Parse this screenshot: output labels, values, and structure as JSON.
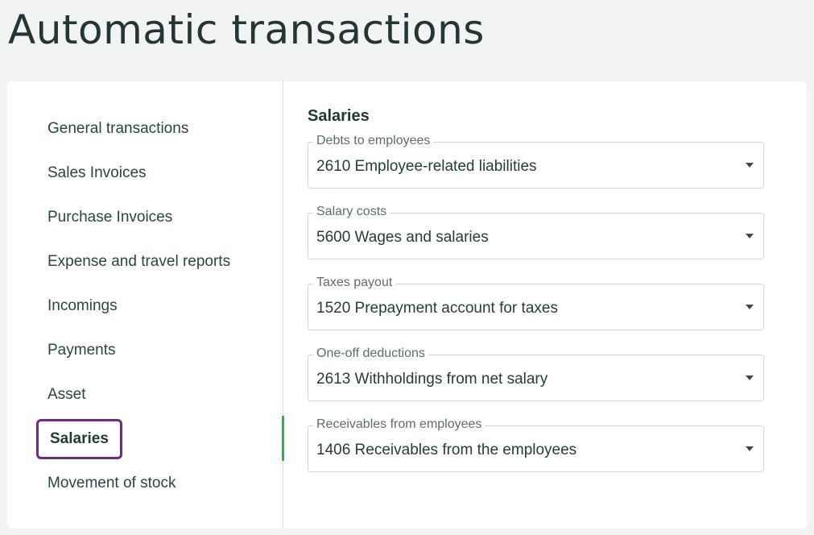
{
  "page": {
    "title": "Automatic transactions"
  },
  "sidebar": {
    "items": [
      {
        "label": "General transactions",
        "active": false
      },
      {
        "label": "Sales Invoices",
        "active": false
      },
      {
        "label": "Purchase Invoices",
        "active": false
      },
      {
        "label": "Expense and travel reports",
        "active": false
      },
      {
        "label": "Incomings",
        "active": false
      },
      {
        "label": "Payments",
        "active": false
      },
      {
        "label": "Asset",
        "active": false
      },
      {
        "label": "Salaries",
        "active": true
      },
      {
        "label": "Movement of stock",
        "active": false
      }
    ]
  },
  "main": {
    "section_title": "Salaries",
    "fields": [
      {
        "label": "Debts to employees",
        "value": "2610 Employee-related liabilities"
      },
      {
        "label": "Salary costs",
        "value": "5600 Wages and salaries"
      },
      {
        "label": "Taxes payout",
        "value": "1520 Prepayment account for taxes"
      },
      {
        "label": "One-off deductions",
        "value": "2613 Withholdings from net salary"
      },
      {
        "label": "Receivables from employees",
        "value": "1406 Receivables from the employees"
      }
    ]
  },
  "colors": {
    "accent_green": "#46a35a",
    "highlight_purple": "#6a2c8a",
    "background": "#f2f4f3"
  }
}
